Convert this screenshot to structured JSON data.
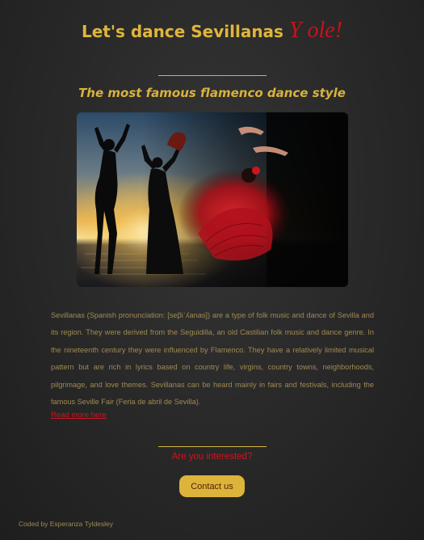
{
  "header": {
    "title": "Let's dance Sevillanas ",
    "title_accent": "Y ole!",
    "subtitle": "The most famous flamenco dance style"
  },
  "hero": {
    "image_alt": "Flamenco dancers silhouetted against a sunset and a dancer in a red dress"
  },
  "content": {
    "description": "Sevillanas (Spanish pronunciation: [seβiˈʎanas]) are a type of folk music and dance of Sevilla and its region. They were derived from the Seguidilla, an old Castilian folk music and dance genre. In the nineteenth century they were influenced by Flamenco. They have a relatively limited musical pattern but are rich in lyrics based on country life, virgins, country towns, neighborhoods, pilgrimage, and love themes. Sevillanas can be heard mainly in fairs and festivals, including the famous Seville Fair (Feria de abril de Sevilla).",
    "read_more": "Read more here"
  },
  "cta": {
    "question": "Are you interested?",
    "button_label": "Contact us"
  },
  "footer": {
    "credit": "Coded by Esperanza Tyldesley"
  },
  "colors": {
    "gold": "#e0b63a",
    "red": "#c8121d",
    "background": "#2a2a2a",
    "body_text": "#a08a52"
  }
}
